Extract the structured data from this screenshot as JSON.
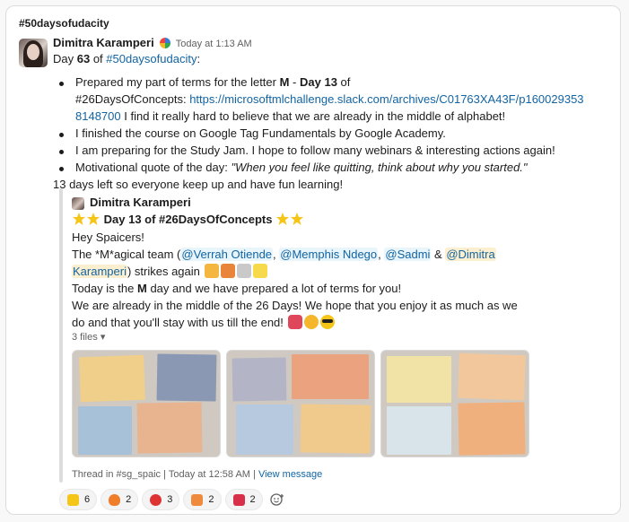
{
  "channel": "#50daysofudacity",
  "message": {
    "sender": "Dimitra Karamperi",
    "timestamp": "Today at 1:13 AM",
    "day_prefix": "Day ",
    "day_number": "63",
    "day_of": " of ",
    "day_channel": "#50daysofudacity",
    "day_suffix": ":",
    "bullet1_a": "Prepared my part of terms for the letter ",
    "bullet1_letter": "M",
    "bullet1_b": " - ",
    "bullet1_day": "Day 13",
    "bullet1_c": " of",
    "bullet1_tag": "#26DaysOfConcepts",
    "bullet1_d": ": ",
    "bullet1_url_1": "https://microsoftmlchallenge.slack.com/archives/C01763XA43F/p160029353",
    "bullet1_url_2": "8148700",
    "bullet1_e": "  I find it really hard to believe that we are already in the middle of alphabet!",
    "bullet2": "I finished the course on Google Tag Fundamentals by Google Academy.",
    "bullet3": "I am preparing for the Study Jam. I hope to follow many webinars & interesting actions again!",
    "bullet4_a": "Motivational quote of the day: ",
    "bullet4_quote": "\"When you feel like quitting, think about why you started.\"",
    "closing": "13 days left so everyone keep up and have fun learning!"
  },
  "quoted": {
    "sender": "Dimitra Karamperi",
    "title_a": "Day  13 of ",
    "title_tag": "#26DaysOfConcepts",
    "greeting": "Hey Spaicers!",
    "team_a": "The *M*agical team (",
    "mention1": "@Verrah Otiende",
    "sep1": ", ",
    "mention2": "@Memphis Ndego",
    "sep2": ", ",
    "mention3": "@Sadmi",
    "sep3": " & ",
    "mention4_a": "@Dimitra",
    "mention4_b": "Karamperi",
    "team_b": ") strikes again",
    "line3_a": "Today is the ",
    "line3_m": "M",
    "line3_b": " day and we have prepared a lot of terms for you!",
    "line4": "We are already in the middle of the 26 Days! We hope that you enjoy it as much as we",
    "line5": "do and that you'll stay with us till the end!",
    "files_label": "3 files",
    "thread_prefix": "Thread in #sg_spaic",
    "thread_sep": " | ",
    "thread_time": "Today at 12:58 AM",
    "thread_sep2": " | ",
    "view_message": "View message"
  },
  "reactions": [
    {
      "icon": "raised-hands-icon",
      "count": "6"
    },
    {
      "icon": "fire-icon",
      "count": "2"
    },
    {
      "icon": "emoji-icon",
      "count": "3"
    },
    {
      "icon": "emoji-icon",
      "count": "2"
    },
    {
      "icon": "heart-icon",
      "count": "2"
    }
  ],
  "colors": {
    "link": "#1264a3",
    "mention_bg": "#e8f5fa",
    "self_mention_bg": "#fcefcf"
  }
}
